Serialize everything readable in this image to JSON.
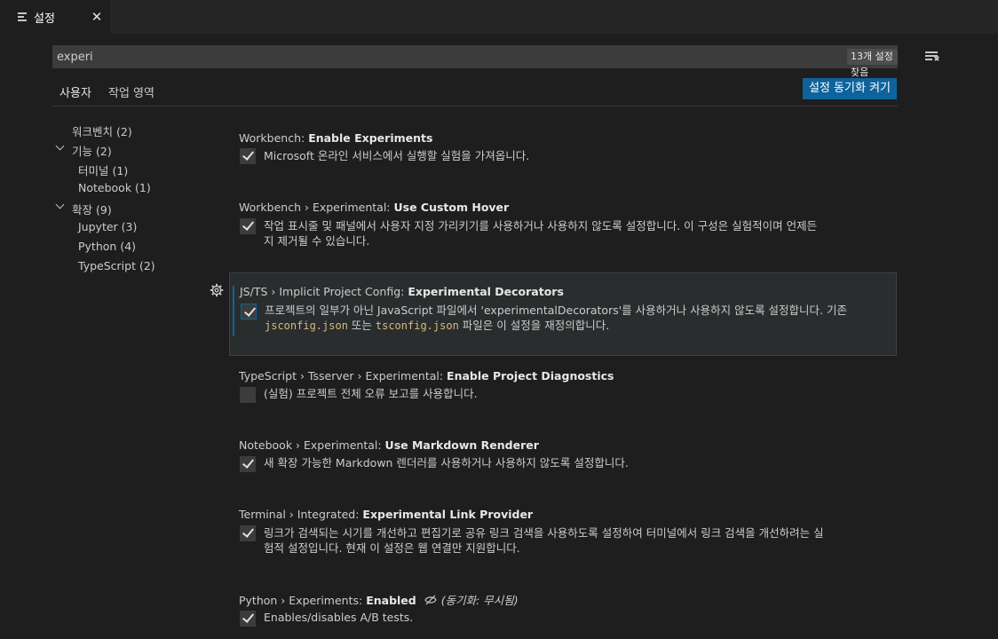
{
  "tab": {
    "title": "설정",
    "close_glyph": "✕",
    "icon": "settings-list-icon"
  },
  "search": {
    "value": "experi",
    "result_count": "13개 설정 찾음",
    "filter_icon": "clear-filter-icon"
  },
  "scope_tabs": {
    "user": "사용자",
    "workspace": "작업 영역"
  },
  "sync_button": "설정 동기화 켜기",
  "toc": [
    {
      "label": "워크벤치",
      "count": "(2)"
    },
    {
      "label": "기능",
      "count": "(2)",
      "expanded": true
    },
    {
      "label": "터미널",
      "count": "(1)"
    },
    {
      "label": "Notebook",
      "count": "(1)"
    },
    {
      "label": "확장",
      "count": "(9)",
      "expanded": true
    },
    {
      "label": "Jupyter",
      "count": "(3)"
    },
    {
      "label": "Python",
      "count": "(4)"
    },
    {
      "label": "TypeScript",
      "count": "(2)"
    }
  ],
  "settings": [
    {
      "category": "Workbench: ",
      "name": "Enable Experiments",
      "checked": true,
      "description": "Microsoft 온라인 서비스에서 실행할 실험을 가져옵니다."
    },
    {
      "category": "Workbench › Experimental: ",
      "name": "Use Custom Hover",
      "checked": true,
      "description_line1": "작업 표시줄 및 패널에서 사용자 지정 가리키기를 사용하거나 사용하지 않도록 설정합니다. 이 구성은 실험적이며 언제든",
      "description_line2": "지 제거될 수 있습니다."
    },
    {
      "category": "JS/TS › Implicit Project Config: ",
      "name": "Experimental Decorators",
      "checked": true,
      "description_line1": "프로젝트의 일부가 아닌 JavaScript 파일에서 'experimentalDecorators'를 사용하거나 사용하지 않도록 설정합니다. 기존",
      "code1": "jsconfig.json",
      "mid": " 또는 ",
      "code2": "tsconfig.json",
      "tail": " 파일은 이 설정을 재정의합니다."
    },
    {
      "category": "TypeScript › Tsserver › Experimental: ",
      "name": "Enable Project Diagnostics",
      "checked": false,
      "description": "(실험) 프로젝트 전체 오류 보고를 사용합니다."
    },
    {
      "category": "Notebook › Experimental: ",
      "name": "Use Markdown Renderer",
      "checked": true,
      "description": "새 확장 가능한 Markdown 렌더러를 사용하거나 사용하지 않도록 설정합니다."
    },
    {
      "category": "Terminal › Integrated: ",
      "name": "Experimental Link Provider",
      "checked": true,
      "description_line1": "링크가 검색되는 시기를 개선하고 편집기로 공유 링크 검색을 사용하도록 설정하여 터미널에서 링크 검색을 개선하려는 실",
      "description_line2": "험적 설정입니다. 현재 이 설정은 웹 연결만 지원합니다."
    },
    {
      "category": "Python › Experiments: ",
      "name": "Enabled",
      "sync_ignored": "(동기화: 무시됨)",
      "checked": true,
      "description": "Enables/disables A/B tests."
    }
  ]
}
